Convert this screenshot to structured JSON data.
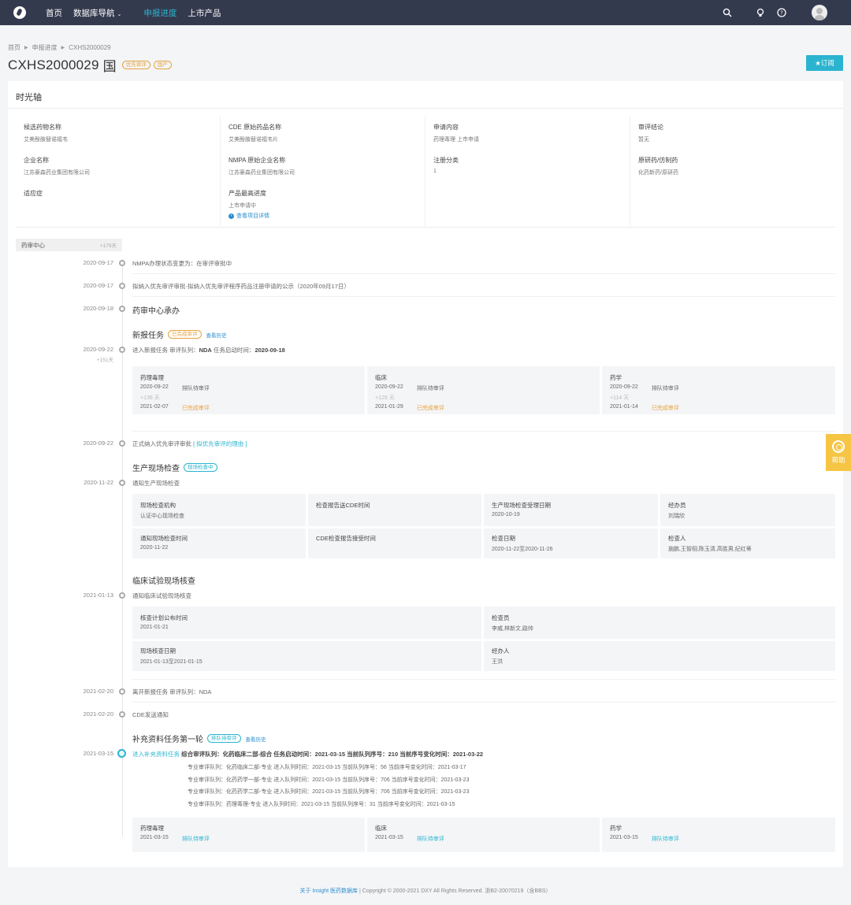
{
  "nav": {
    "items": [
      "首页",
      "数据库导航",
      "申报进度",
      "上市产品"
    ],
    "active_index": 2
  },
  "breadcrumb": [
    "首页",
    "申报进度",
    "CXHS2000029"
  ],
  "header": {
    "title": "CXHS2000029",
    "country_glyph": "国",
    "tags": [
      "优先审评",
      "国产"
    ],
    "subscribe": "★订阅"
  },
  "card_title": "时光轴",
  "info": {
    "c1": [
      {
        "label": "候选药物名称",
        "value": "艾美酚胺替诺福韦"
      },
      {
        "label": "企业名称",
        "value": "江苏豪森药业集团有限公司"
      },
      {
        "label": "适应症",
        "value": ""
      }
    ],
    "c2": [
      {
        "label": "CDE 原始药品名称",
        "value": "艾美酚胺替诺福韦片"
      },
      {
        "label": "NMPA 原始企业名称",
        "value": "江苏豪森药业集团有限公司"
      },
      {
        "label": "产品最高进度",
        "value": "上市申请中",
        "link": "查看项目详情"
      }
    ],
    "c3": [
      {
        "label": "申请内容",
        "value": "药理毒理  上市申请"
      },
      {
        "label": "注册分类",
        "value": "1"
      }
    ],
    "c4": [
      {
        "label": "审评结论",
        "value": "暂无"
      },
      {
        "label": "原研药/仿制药",
        "value": "化药新药/原研药"
      }
    ]
  },
  "timeline": {
    "center_label": "药审中心",
    "center_days": "+179天",
    "events": {
      "e1": {
        "date": "2020-09-17",
        "text": "NMPA办理状态变更为：在审评审批中"
      },
      "e2": {
        "date": "2020-09-17",
        "text": "拟纳入优先审评审批-拟纳入优先审评程序药品注册申请的公示（2020年09月17日）"
      },
      "e3": {
        "date": "2020-09-18",
        "title": "药审中心承办"
      },
      "e4": {
        "title": "新报任务",
        "tag": "已完成审评",
        "history": "查看历史",
        "date": "2020-09-22",
        "rel": "+151天",
        "line_pre": "进入新报任务  审评队列：",
        "queue": "NDA",
        "line_mid": "  任务启动时间：",
        "start": "2020-09-18",
        "cells": [
          {
            "title": "药理毒理",
            "d1": "2020-09-22",
            "s1": "排队待审评",
            "rel": "+138 天",
            "d2": "2021-02-07",
            "s2": "已完成审评"
          },
          {
            "title": "临床",
            "d1": "2020-09-22",
            "s1": "排队待审评",
            "rel": "+129 天",
            "d2": "2021-01-29",
            "s2": "已完成审评"
          },
          {
            "title": "药学",
            "d1": "2020-09-22",
            "s1": "排队待审评",
            "rel": "+114 天",
            "d2": "2021-01-14",
            "s2": "已完成审评"
          }
        ]
      },
      "e5": {
        "date": "2020-09-22",
        "text": "正式纳入优先审评审批",
        "reason": "[ 拟优先审评的理由 ]"
      },
      "e6": {
        "title": "生产现场检查",
        "tag": "现场检查中",
        "date": "2020-11-22",
        "text": "通知生产现场检查",
        "cells": [
          [
            {
              "label": "现场检查机构",
              "value": "认证中心现场检查"
            },
            {
              "label": "通知现场检查时间",
              "value": "2020-11-22"
            }
          ],
          [
            {
              "label": "检查报告送CDE时间",
              "value": ""
            },
            {
              "label": "CDE检查报告接受时间",
              "value": ""
            }
          ],
          [
            {
              "label": "生产现场检查受理日期",
              "value": "2020-10-19"
            },
            {
              "label": "检查日期",
              "value": "2020-11-22至2020-11-26"
            }
          ],
          [
            {
              "label": "经办员",
              "value": "刘瑞欣"
            },
            {
              "label": "检查人",
              "value": "施鹏,王智栩,陈玉清,高胜男,纪红蒂"
            }
          ]
        ]
      },
      "e7": {
        "title": "临床试验现场核查",
        "date": "2021-01-13",
        "text": "通知临床试验现场核查",
        "cells": [
          [
            {
              "label": "核查计划公布时间",
              "value": "2021-01-21"
            },
            {
              "label": "现场核查日期",
              "value": "2021-01-13至2021-01-15"
            }
          ],
          [
            {
              "label": "检查员",
              "value": "李威,林新文,路帅"
            },
            {
              "label": "经办人",
              "value": "王洪"
            }
          ]
        ]
      },
      "e8": {
        "date": "2021-02-20",
        "text": "离开新报任务  审评队列：NDA"
      },
      "e9": {
        "date": "2021-02-20",
        "text": "CDE发送通知"
      },
      "e10": {
        "title": "补充资料任务第一轮",
        "tag": "排队待审评",
        "history": "查看历史",
        "date": "2021-03-15",
        "lead": "进入补充资料任务",
        "main": "综合审评队列：化药临床二部-综合  任务启动时间：2021-03-15  当前队列序号：210  当前序号变化时间：2021-03-22",
        "subs": [
          "专业审评队列：化药临床二部-专业  进入队列时间：2021-03-15  当前队列序号：56  当前序号变化时间：2021-03-17",
          "专业审评队列：化药药学一部-专业  进入队列时间：2021-03-15  当前队列序号：706  当前序号变化时间：2021-03-23",
          "专业审评队列：化药药学二部-专业  进入队列时间：2021-03-15  当前队列序号：706  当前序号变化时间：2021-03-23",
          "专业审评队列：药理毒理-专业  进入队列时间：2021-03-15  当前队列序号：31  当前序号变化时间：2021-03-15"
        ],
        "cells": [
          {
            "title": "药理毒理",
            "d1": "2021-03-15",
            "s1": "排队待审评"
          },
          {
            "title": "临床",
            "d1": "2021-03-15",
            "s1": "排队待审评"
          },
          {
            "title": "药学",
            "d1": "2021-03-15",
            "s1": "排队待审评"
          }
        ]
      }
    }
  },
  "footer": {
    "link": "关于 Insight 医药数据库",
    "rest": " | Copyright © 2000-2021 DXY All Rights Reserved. 浙B2-20070219（含BBS）"
  },
  "help": "帮助",
  "colors": {
    "topbar": "#343a4e",
    "accent": "#2bb4cf",
    "orange": "#e6a23c",
    "help": "#f6c544"
  }
}
